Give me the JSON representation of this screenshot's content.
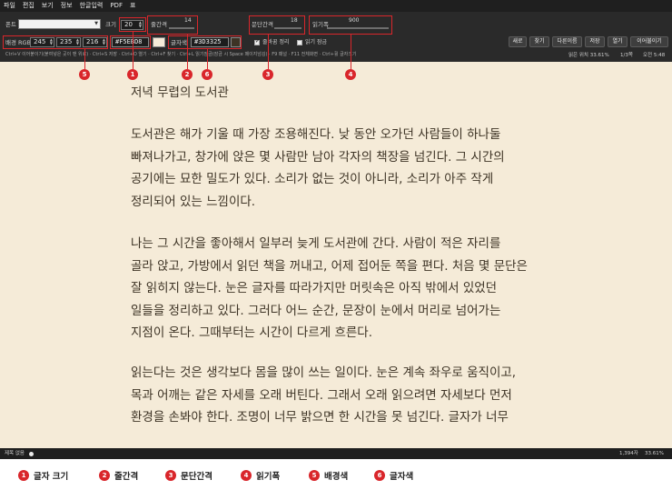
{
  "menu": [
    "파일",
    "편집",
    "보기",
    "정보",
    "한글입력",
    "PDF",
    "표"
  ],
  "toolbar": {
    "font_label": "폰트",
    "font_value": "",
    "size_label": "크기",
    "size_value": "20",
    "line_spacing_label": "줄간격",
    "line_spacing_value": "14",
    "para_spacing_label": "문단간격",
    "para_spacing_value": "18",
    "read_width_label": "읽기폭",
    "read_width_value": "900",
    "bg_label": "배경 RGB",
    "bg_r": "245",
    "bg_g": "235",
    "bg_b": "216",
    "bg_hex": "#F5EBD8",
    "text_color_label": "글자색",
    "text_hex": "#3D3325",
    "check_spacing_label": "줄바꿈 정리",
    "check_spacing_checked": true,
    "check_read_label": "읽기 잠금",
    "check_read_checked": false,
    "buttons": [
      "새로",
      "찾기",
      "다른이름",
      "저장",
      "열기",
      "이어불이기"
    ],
    "hint": "Ctrl+V 이어붙이기(붙여넣은 곳이 맨 위로) · Ctrl+S 저장 · Ctrl+O 열기 · Ctrl+F 찾기 · Ctrl+L 읽기잠금(잠금 시 Space 페이지넘김) · F9 패널 · F11 전체화면 · Ctrl+휠 글자크기",
    "position_text": "읽은 위치 33.61%",
    "page_text": "1/3쪽",
    "clock_text": "오전 5:48"
  },
  "document": {
    "title": "저녁 무렵의 도서관",
    "paragraphs": [
      [
        "도서관은 해가 기울 때 가장 조용해진다. 낮 동안 오가던 사람들이 하나둘",
        "빠져나가고, 창가에 앉은 몇 사람만 남아 각자의 책장을 넘긴다. 그 시간의",
        "공기에는 묘한 밀도가 있다. 소리가 없는 것이 아니라, 소리가 아주 작게",
        "정리되어 있는 느낌이다."
      ],
      [
        "나는 그 시간을 좋아해서 일부러 늦게 도서관에 간다. 사람이 적은 자리를",
        "골라 앉고, 가방에서 읽던 책을 꺼내고, 어제 접어둔 쪽을 편다. 처음 몇 문단은",
        "잘 읽히지 않는다. 눈은 글자를 따라가지만 머릿속은 아직 밖에서 있었던",
        "일들을 정리하고 있다. 그러다 어느 순간, 문장이 눈에서 머리로 넘어가는",
        "지점이 온다. 그때부터는 시간이 다르게 흐른다."
      ],
      [
        "읽는다는 것은 생각보다 몸을 많이 쓰는 일이다. 눈은 계속 좌우로 움직이고,",
        "목과 어깨는 같은 자세를 오래 버틴다. 그래서 오래 읽으려면 자세보다 먼저",
        "환경을 손봐야 한다. 조명이 너무 밝으면 한 시간을 못 넘긴다. 글자가 너무"
      ]
    ]
  },
  "statusbar": {
    "left": "제목 없음",
    "chars": "1,394자",
    "percent": "33.61%"
  },
  "markers": [
    "1",
    "2",
    "3",
    "4",
    "5",
    "6"
  ],
  "legend": [
    {
      "num": "1",
      "label": "글자 크기"
    },
    {
      "num": "2",
      "label": "줄간격"
    },
    {
      "num": "3",
      "label": "문단간격"
    },
    {
      "num": "4",
      "label": "읽기폭"
    },
    {
      "num": "5",
      "label": "배경색"
    },
    {
      "num": "6",
      "label": "글자색"
    }
  ],
  "colors": {
    "accent_red": "#d9262b",
    "page_bg": "#F5EBD8",
    "text": "#3D3325"
  }
}
